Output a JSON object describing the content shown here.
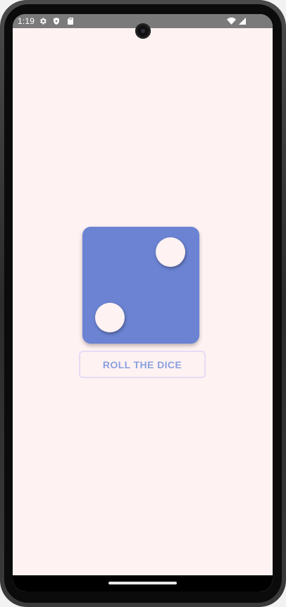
{
  "status_bar": {
    "time": "1:19",
    "left_icons": [
      "settings-gear-icon",
      "shield-play-icon",
      "sd-card-icon"
    ],
    "right_icons": [
      "wifi-icon",
      "signal-icon"
    ]
  },
  "dice": {
    "face_value": 2,
    "color": "#6b83d2",
    "pip_color": "#fff2f2"
  },
  "roll_button": {
    "label": "ROLL THE DICE",
    "text_color": "#8aa0e0",
    "border_color": "#e6dcf6"
  },
  "colors": {
    "screen_background": "#fff2f2",
    "status_bar": "#7a7a7a",
    "nav_bar": "#000000"
  }
}
